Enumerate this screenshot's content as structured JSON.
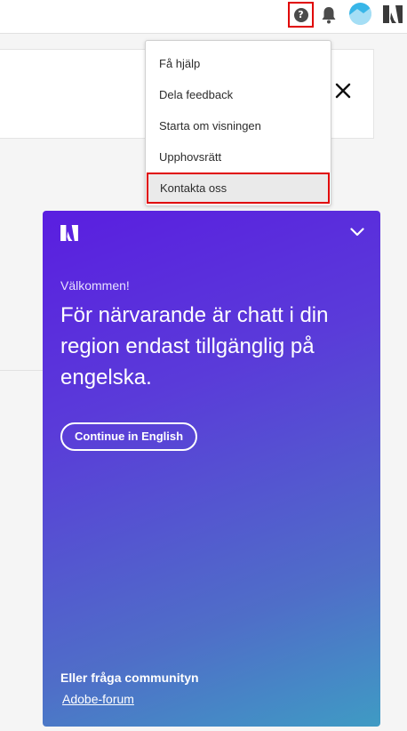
{
  "menu": {
    "items": [
      {
        "label": "Få hjälp"
      },
      {
        "label": "Dela feedback"
      },
      {
        "label": "Starta om visningen"
      },
      {
        "label": "Upphovsrätt"
      },
      {
        "label": "Kontakta oss"
      }
    ]
  },
  "chat": {
    "welcome": "Välkommen!",
    "headline": "För närvarande är chatt i din region endast tillgänglig på engelska.",
    "cta_label": "Continue in English",
    "community_label": "Eller fråga communityn",
    "forum_link": "Adobe-forum"
  },
  "header": {
    "icons": [
      "help-icon",
      "bell-icon",
      "avatar",
      "adobe-logo-icon"
    ]
  },
  "colors": {
    "highlight": "#e00000",
    "chat_gradient_start": "#5a1ee0",
    "chat_gradient_end": "#3f9bc4",
    "avatar": "#38b6e8"
  }
}
